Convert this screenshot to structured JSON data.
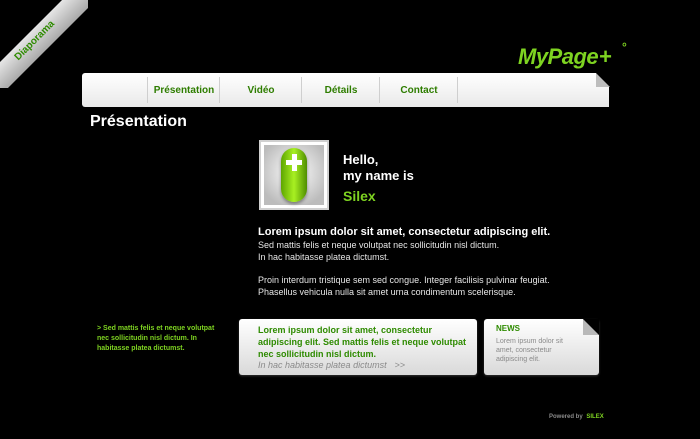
{
  "corner": {
    "label": "Diaporama"
  },
  "logo": {
    "text": "MyPage",
    "plus": "+",
    "degree": "°"
  },
  "nav": {
    "items": [
      "Présentation",
      "Vidéo",
      "Détails",
      "Contact"
    ]
  },
  "page": {
    "title": "Présentation"
  },
  "profile": {
    "hello_line1": "Hello,",
    "hello_line2": "my name is",
    "name": "Silex"
  },
  "content": {
    "lead": "Lorem ipsum dolor sit amet, consectetur adipiscing elit.",
    "p1_line1": "Sed mattis felis et neque volutpat nec sollicitudin nisl dictum.",
    "p1_line2": "In hac habitasse platea dictumst.",
    "p2_line1": "Proin interdum tristique sem sed congue. Integer facilisis pulvinar feugiat.",
    "p2_line2": "Phasellus vehicula nulla sit amet urna condimentum scelerisque."
  },
  "side_note": "> Sed mattis felis et neque volutpat nec sollicitudin nisl dictum. In habitasse platea dictumst.",
  "card_main": {
    "title": "Lorem ipsum dolor sit amet, consectetur adipiscing elit. Sed mattis felis et neque volutpat nec sollicitudin nisl dictum.",
    "sub": "In hac habitasse platea dictumst",
    "arrow": ">>"
  },
  "news": {
    "heading": "NEWS",
    "body": "Lorem ipsum dolor sit amet, consectetur adipiscing elit."
  },
  "footer": {
    "prefix": "Powered by",
    "brand": "SILEX"
  },
  "colors": {
    "accent": "#7ed321",
    "accent_dark": "#2e8b00",
    "background": "#000000"
  }
}
